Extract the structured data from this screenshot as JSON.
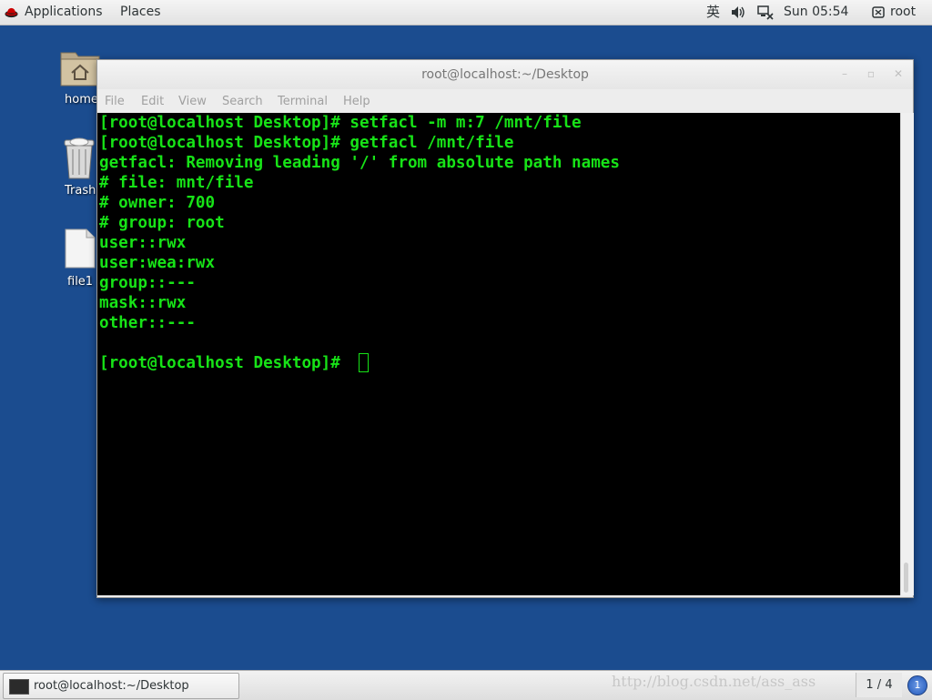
{
  "topbar": {
    "applications": "Applications",
    "places": "Places",
    "input_method": "英",
    "clock": "Sun 05:54",
    "user": "root"
  },
  "desktop": {
    "icons": [
      {
        "label": "home",
        "icon": "home-folder-icon"
      },
      {
        "label": "Trash",
        "icon": "trash-icon"
      },
      {
        "label": "file1",
        "icon": "document-icon"
      }
    ]
  },
  "window": {
    "title": "root@localhost:~/Desktop",
    "menu": [
      "File",
      "Edit",
      "View",
      "Search",
      "Terminal",
      "Help"
    ]
  },
  "terminal": {
    "lines": [
      "[root@localhost Desktop]# setfacl -m m:7 /mnt/file",
      "[root@localhost Desktop]# getfacl /mnt/file",
      "getfacl: Removing leading '/' from absolute path names",
      "# file: mnt/file",
      "# owner: 700",
      "# group: root",
      "user::rwx",
      "user:wea:rwx",
      "group::---",
      "mask::rwx",
      "other::---",
      "",
      "[root@localhost Desktop]# "
    ],
    "text_color": "#17e317",
    "background": "#000000"
  },
  "taskbar": {
    "task_label": "root@localhost:~/Desktop",
    "watermark": "http://blog.csdn.net/ass_ass",
    "workspace": "1 / 4",
    "notification_count": "1"
  },
  "colors": {
    "desktop_bg": "#1b4c8f"
  }
}
